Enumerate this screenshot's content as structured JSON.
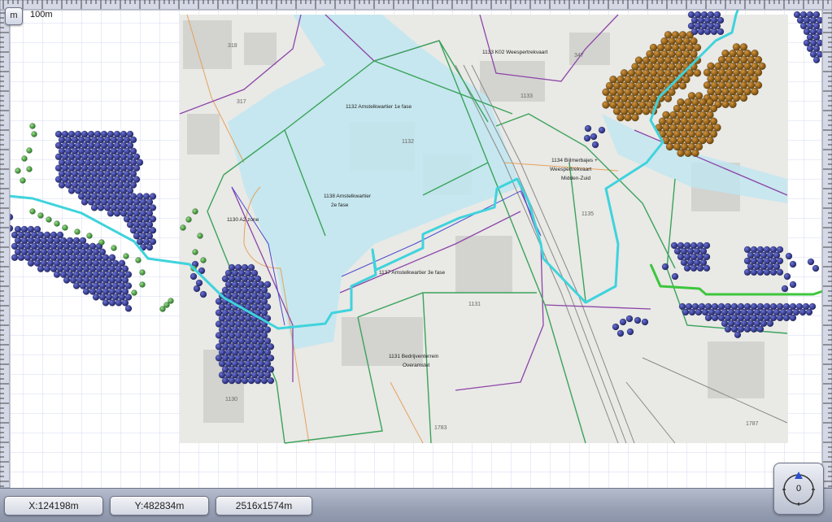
{
  "toolbar": {
    "unit_button_label": "m",
    "scale_label": "100m"
  },
  "status": {
    "x_readout": "X:124198m",
    "y_readout": "Y:482834m",
    "extent_readout": "2516x1574m"
  },
  "compass": {
    "rotation_label": "0",
    "icon": "north-arrow-icon"
  },
  "map": {
    "area_labels": [
      "1133 K02 Weespertrekvaart",
      "1132 Amstelkwartier 1e fase",
      "1134 Bijlmerbajes +",
      "Weespertrekvaart",
      "Midden-Zuid",
      "1138 Amstelkwartier",
      "2e fase",
      "1130 A2 zone",
      "1137 Amstelkwartier 3e fase",
      "1131 Bedrijventerrein",
      "Overamstel"
    ],
    "parcel_numbers": [
      "318",
      "317",
      "347",
      "1133",
      "1132",
      "1135",
      "1131",
      "1130",
      "1783",
      "1787"
    ]
  },
  "colors": {
    "grid": "#d4d8f0",
    "route_cyan": "#3fd3dc",
    "route_green": "#3cc63c",
    "dots_blue": "#2c3184",
    "dots_brown": "#8a5a12",
    "dots_green": "#3a9a32",
    "water": "#bfe6f0",
    "zone_green": "#3aa35a",
    "zone_purple": "#8c45a8"
  }
}
